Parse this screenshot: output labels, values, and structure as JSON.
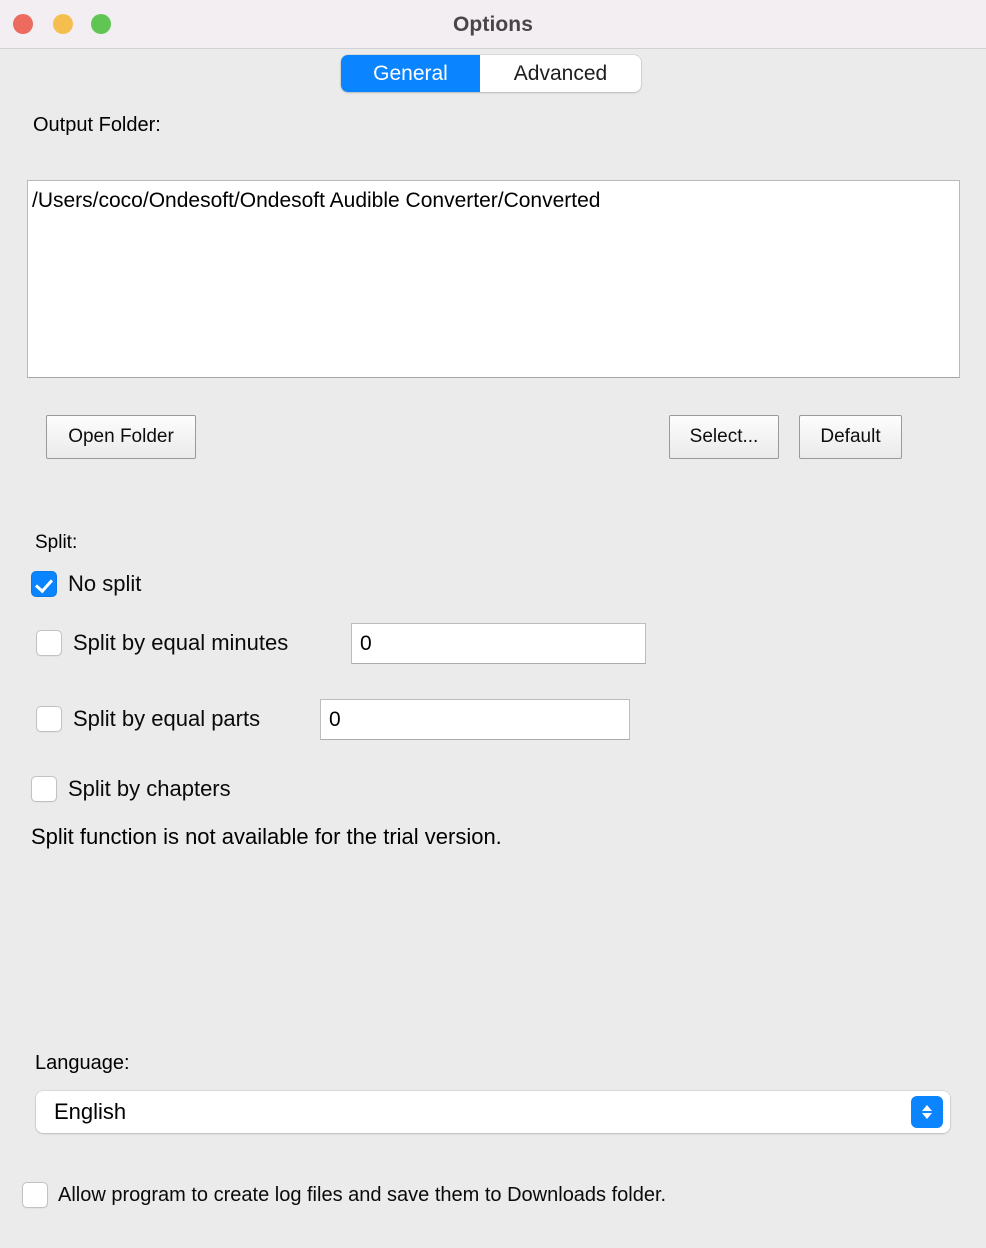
{
  "window": {
    "title": "Options",
    "traffic_lights": [
      {
        "name": "close",
        "color": "#ec6a5e"
      },
      {
        "name": "minimize",
        "color": "#f5bf4f"
      },
      {
        "name": "zoom",
        "color": "#61c554"
      }
    ]
  },
  "tabs": {
    "selected": "General",
    "accent_color": "#0a84ff",
    "items": [
      {
        "label": "General"
      },
      {
        "label": "Advanced"
      }
    ]
  },
  "output_folder": {
    "label": "Output Folder:",
    "path": "/Users/coco/Ondesoft/Ondesoft Audible Converter/Converted",
    "buttons": {
      "open_folder": "Open Folder",
      "select": "Select...",
      "default": "Default"
    }
  },
  "split": {
    "label": "Split:",
    "options": [
      {
        "label": "No split",
        "checked": true
      },
      {
        "label": "Split by equal minutes",
        "checked": false,
        "value": "0"
      },
      {
        "label": "Split by equal parts",
        "checked": false,
        "value": "0"
      },
      {
        "label": "Split by chapters",
        "checked": false
      }
    ],
    "note": "Split function is not available for the trial version."
  },
  "language": {
    "label": "Language:",
    "selected": "English"
  },
  "logging": {
    "label": "Allow program to create log files and save them to Downloads folder.",
    "checked": false
  }
}
